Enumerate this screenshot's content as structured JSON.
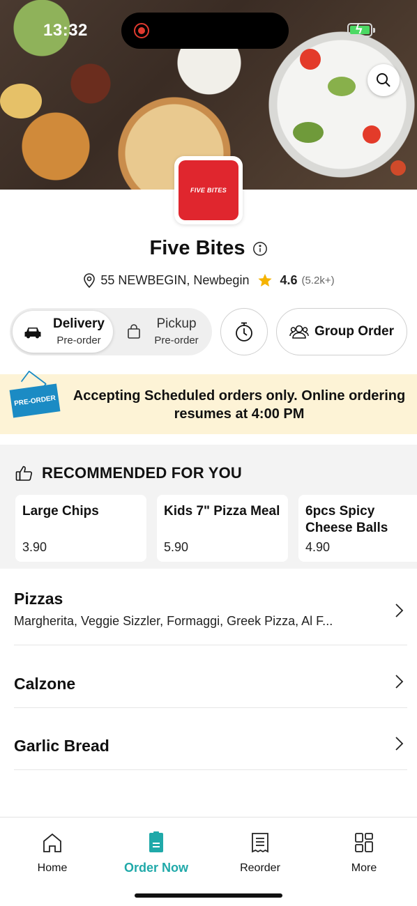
{
  "status": {
    "time": "13:32"
  },
  "store": {
    "logo_text": "FIVE BITES",
    "name": "Five Bites",
    "address": "55 NEWBEGIN, Newbegin",
    "rating": "4.6",
    "rating_count": "(5.2k+)"
  },
  "order_type": {
    "delivery_label": "Delivery",
    "delivery_sub": "Pre-order",
    "pickup_label": "Pickup",
    "pickup_sub": "Pre-order",
    "selected": "Delivery",
    "group_order_label": "Group Order"
  },
  "banner": {
    "tag": "PRE-ORDER",
    "message": "Accepting Scheduled orders only. Online ordering resumes at 4:00 PM"
  },
  "recommended": {
    "heading": "RECOMMENDED FOR YOU",
    "items": [
      {
        "name": "Large Chips",
        "price": "3.90"
      },
      {
        "name": "Kids 7\" Pizza Meal",
        "price": "5.90"
      },
      {
        "name": "6pcs Spicy Cheese Balls",
        "price": "4.90"
      }
    ]
  },
  "categories": [
    {
      "title": "Pizzas",
      "subtitle": "Margherita, Veggie Sizzler, Formaggi, Greek Pizza, Al F..."
    },
    {
      "title": "Calzone"
    },
    {
      "title": "Garlic Bread"
    }
  ],
  "tabbar": {
    "tabs": [
      {
        "label": "Home",
        "icon": "home-icon"
      },
      {
        "label": "Order Now",
        "icon": "order-now-icon"
      },
      {
        "label": "Reorder",
        "icon": "receipt-icon"
      },
      {
        "label": "More",
        "icon": "grid-icon"
      }
    ],
    "active": "Order Now",
    "accent_color": "#20a9a9"
  },
  "colors": {
    "brand_red": "#e0262e",
    "banner_bg": "#fdf3d6",
    "star": "#f5b301"
  }
}
